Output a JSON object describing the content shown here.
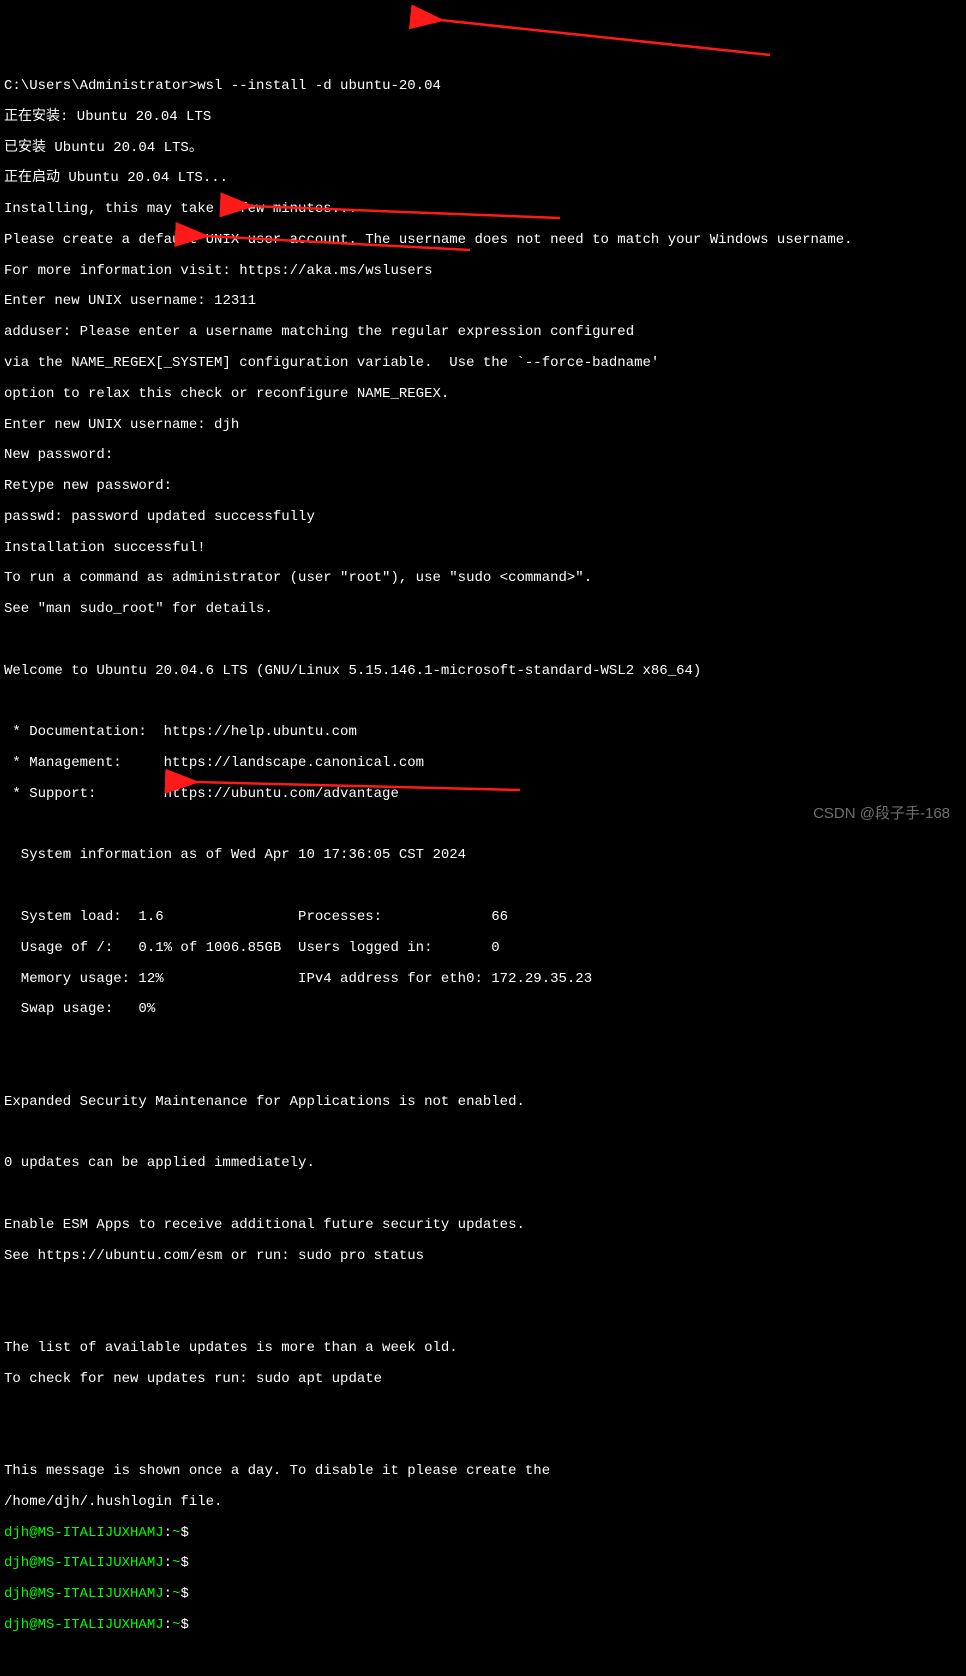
{
  "prompt_win": "C:\\Users\\Administrator>",
  "cmd": "wsl --install -d ubuntu-20.04",
  "installing_zh": "正在安装: Ubuntu 20.04 LTS",
  "installed_zh": "已安装 Ubuntu 20.04 LTS。",
  "starting_zh": "正在启动 Ubuntu 20.04 LTS...",
  "installing": "Installing, this may take a few minutes...",
  "create_account": "Please create a default UNIX user account. The username does not need to match your Windows username.",
  "more_info": "For more information visit: https://aka.ms/wslusers",
  "enter_user1_label": "Enter new UNIX username: ",
  "enter_user1_value": "12311",
  "adduser_err1": "adduser: Please enter a username matching the regular expression configured",
  "adduser_err2": "via the NAME_REGEX[_SYSTEM] configuration variable.  Use the `--force-badname'",
  "adduser_err3": "option to relax this check or reconfigure NAME_REGEX.",
  "enter_user2_label": "Enter new UNIX username: ",
  "enter_user2_value": "djh",
  "new_pw": "New password:",
  "retype_pw": "Retype new password:",
  "pw_updated": "passwd: password updated successfully",
  "install_ok": "Installation successful!",
  "sudo_hint1": "To run a command as administrator (user \"root\"), use \"sudo <command>\".",
  "sudo_hint2": "See \"man sudo_root\" for details.",
  "welcome": "Welcome to Ubuntu 20.04.6 LTS (GNU/Linux 5.15.146.1-microsoft-standard-WSL2 x86_64)",
  "doc": " * Documentation:  https://help.ubuntu.com",
  "mgmt": " * Management:     https://landscape.canonical.com",
  "supp": " * Support:        https://ubuntu.com/advantage",
  "sysinfo_hdr": "  System information as of Wed Apr 10 17:36:05 CST 2024",
  "sys_row1": "  System load:  1.6                Processes:             66",
  "sys_row2": "  Usage of /:   0.1% of 1006.85GB  Users logged in:       0",
  "sys_row3": "  Memory usage: 12%                IPv4 address for eth0: 172.29.35.23",
  "sys_row4": "  Swap usage:   0%",
  "esm1": "Expanded Security Maintenance for Applications is not enabled.",
  "updates0": "0 updates can be applied immediately.",
  "esm2": "Enable ESM Apps to receive additional future security updates.",
  "esm3": "See https://ubuntu.com/esm or run: sudo pro status",
  "oldlist1": "The list of available updates is more than a week old.",
  "oldlist2": "To check for new updates run: sudo apt update",
  "hush1": "This message is shown once a day. To disable it please create the",
  "hush2": "/home/djh/.hushlogin file.",
  "ps1": "djh@MS-ITALIJUXHAMJ",
  "ps_sep": ":",
  "ps_path": "~",
  "ps_dollar": "$",
  "watermark": "CSDN @段子手-168"
}
